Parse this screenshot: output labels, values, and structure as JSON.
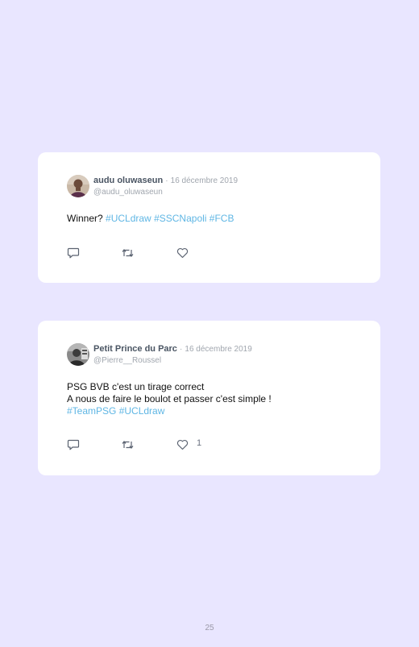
{
  "tweets": [
    {
      "display_name": "audu oluwaseun",
      "separator": "·",
      "date": "16 décembre 2019",
      "handle": "@audu_oluwaseun",
      "lines": [
        [
          {
            "text": "Winner? ",
            "hashtag": false
          },
          {
            "text": "#UCLdraw",
            "hashtag": true
          },
          {
            "text": " ",
            "hashtag": false
          },
          {
            "text": "#SSCNapoli",
            "hashtag": true
          },
          {
            "text": " ",
            "hashtag": false
          },
          {
            "text": "#FCB",
            "hashtag": true
          }
        ]
      ],
      "like_count": ""
    },
    {
      "display_name": "Petit Prince du Parc",
      "separator": "·",
      "date": "16 décembre 2019",
      "handle": "@Pierre__Roussel",
      "lines": [
        [
          {
            "text": "PSG BVB c'est un tirage correct",
            "hashtag": false
          }
        ],
        [
          {
            "text": "A nous de faire le boulot et passer c'est simple !",
            "hashtag": false
          }
        ],
        [
          {
            "text": "#TeamPSG",
            "hashtag": true
          },
          {
            "text": " ",
            "hashtag": false
          },
          {
            "text": "#UCLdraw",
            "hashtag": true
          }
        ]
      ],
      "like_count": "1"
    }
  ],
  "icons": {
    "reply": "reply-icon",
    "retweet": "retweet-icon",
    "like": "heart-icon"
  },
  "colors": {
    "background": "#e9e6ff",
    "card": "#ffffff",
    "hashtag": "#5fb6e4",
    "muted": "#a0a6ae",
    "name": "#4a5563"
  },
  "page": {
    "number": "25"
  }
}
